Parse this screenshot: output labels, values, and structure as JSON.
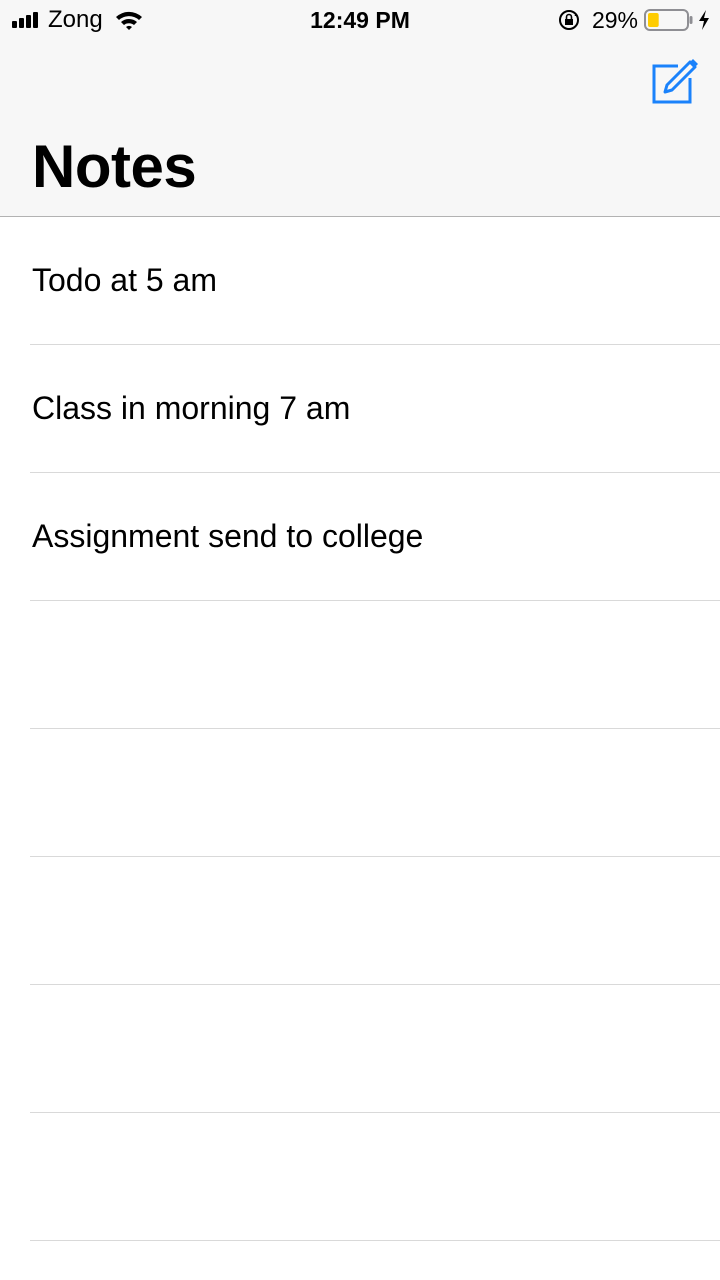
{
  "status_bar": {
    "carrier": "Zong",
    "time": "12:49 PM",
    "battery_percent": "29%",
    "battery_level": 0.29,
    "battery_color": "#ffcc00"
  },
  "header": {
    "title": "Notes",
    "compose_icon": "compose-icon",
    "accent_color": "#1a82fb"
  },
  "notes": [
    {
      "title": "Todo at 5 am"
    },
    {
      "title": "Class in morning 7 am"
    },
    {
      "title": "Assignment send to college"
    },
    {
      "title": ""
    },
    {
      "title": ""
    },
    {
      "title": ""
    },
    {
      "title": ""
    },
    {
      "title": ""
    }
  ]
}
